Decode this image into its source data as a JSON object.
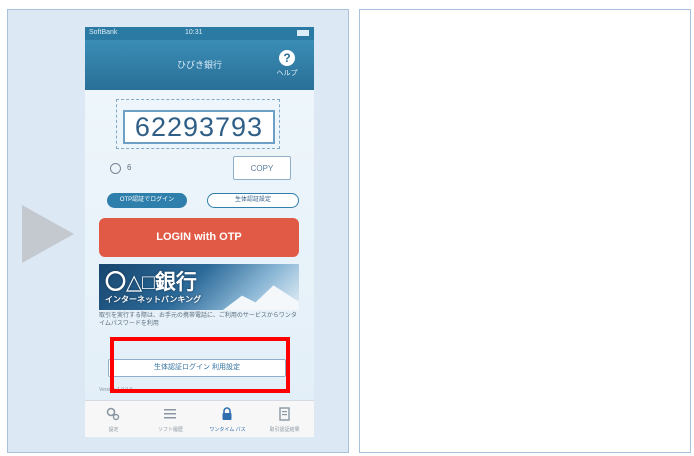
{
  "status_bar": {
    "carrier": "SoftBank",
    "time": "10:31"
  },
  "nav": {
    "title": "ひびき銀行",
    "help_icon": "?",
    "help_label": "ヘルプ"
  },
  "otp": {
    "code": "62293793",
    "timer_value": "6",
    "copy_label": "COPY"
  },
  "tabs": {
    "otp_login": "OTP認証でログイン",
    "bio_login": "生体認証設定"
  },
  "login_button": "LOGIN with OTP",
  "banner": {
    "title": "〇△□銀行",
    "subtitle": "インターネットバンキング"
  },
  "description": "取引を実行する際は、お手元の携帯電話に、ご利用のサービスからワンタイムパスワードを利用",
  "biometric_link": "生体認証ログイン 利用設定",
  "version": "Version 1.0.0.0",
  "tabbar": [
    {
      "label": "設定",
      "icon": "gear-icon",
      "active": false
    },
    {
      "label": "ソフト履歴",
      "icon": "list-icon",
      "active": false
    },
    {
      "label": "ワンタイム パス",
      "icon": "lock-icon",
      "active": true
    },
    {
      "label": "取引認証結果",
      "icon": "document-icon",
      "active": false
    }
  ],
  "colors": {
    "accent": "#2f7fac",
    "login_button": "#e15a45",
    "highlight": "#ff0000"
  }
}
